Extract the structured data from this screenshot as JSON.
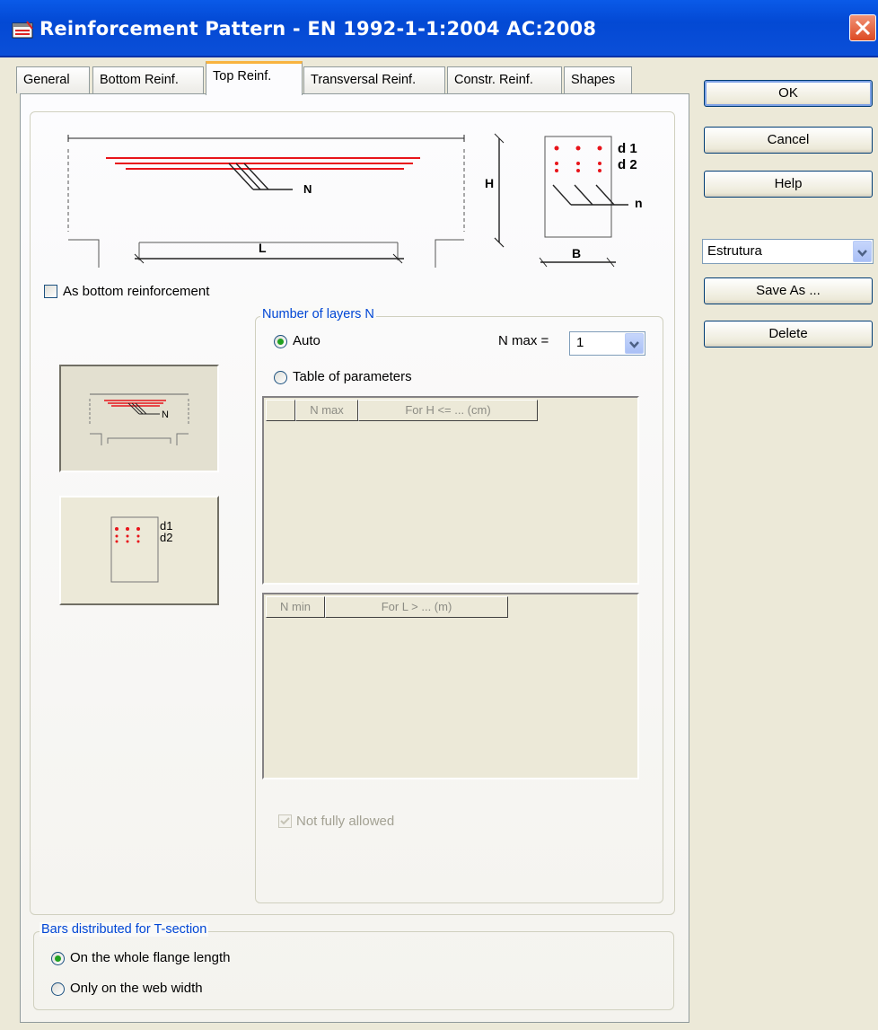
{
  "window": {
    "title": "Reinforcement Pattern - EN 1992-1-1:2004 AC:2008"
  },
  "tabs": [
    {
      "label": "General"
    },
    {
      "label": "Bottom Reinf."
    },
    {
      "label": "Top Reinf."
    },
    {
      "label": "Transversal Reinf."
    },
    {
      "label": "Constr. Reinf."
    },
    {
      "label": "Shapes"
    }
  ],
  "diagram": {
    "label_n_upper": "N",
    "label_h": "H",
    "label_l": "L",
    "label_d1": "d 1",
    "label_d2": "d 2",
    "label_n_lower": "n",
    "label_b": "B"
  },
  "as_bottom": {
    "label": "As bottom reinforcement",
    "checked": false
  },
  "preview1": {
    "label_n": "N"
  },
  "preview2": {
    "label_d1": "d1",
    "label_d2": "d2"
  },
  "layers": {
    "title": "Number of layers N",
    "auto_label": "Auto",
    "table_label": "Table of parameters",
    "nmax_label": "N max =",
    "nmax_value": "1",
    "table1_headers": [
      "",
      "N max",
      "For H <= ... (cm)"
    ],
    "table2_headers": [
      "N min",
      "For L > ... (m)"
    ],
    "not_fully_allowed": "Not fully allowed"
  },
  "tsection": {
    "title": "Bars distributed for T-section",
    "option1": "On the whole flange length",
    "option2": "Only on the web width"
  },
  "buttons": {
    "ok": "OK",
    "cancel": "Cancel",
    "help": "Help",
    "save_as": "Save As ...",
    "delete": "Delete"
  },
  "preset": {
    "value": "Estrutura"
  },
  "colors": {
    "title_bar": "#0a5ae8",
    "rebar": "#e8141a",
    "group_title": "#0046d5",
    "radio_dot": "#21a121"
  }
}
